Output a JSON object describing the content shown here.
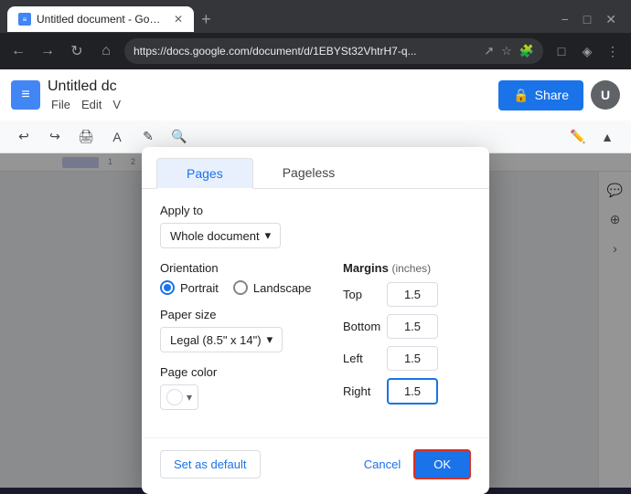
{
  "browser": {
    "tab_title": "Untitled document - Google Do...",
    "address": "https://docs.google.com/document/d/1EBYSt32VhtrH7-q...",
    "new_tab_label": "+",
    "favicon_label": "≡"
  },
  "app": {
    "title": "Untitled dc",
    "menu_items": [
      "File",
      "Edit",
      "V"
    ],
    "share_label": "Share",
    "docs_icon": "≡"
  },
  "dialog": {
    "tab_pages": "Pages",
    "tab_pageless": "Pageless",
    "apply_to_label": "Apply to",
    "apply_to_value": "Whole document",
    "orientation_label": "Orientation",
    "portrait_label": "Portrait",
    "landscape_label": "Landscape",
    "paper_size_label": "Paper size",
    "paper_size_value": "Legal (8.5\" x 14\")",
    "page_color_label": "Page color",
    "margins_label": "Margins",
    "margins_unit": "(inches)",
    "top_label": "Top",
    "top_value": "1.5",
    "bottom_label": "Bottom",
    "bottom_value": "1.5",
    "left_label": "Left",
    "left_value": "1.5",
    "right_label": "Right",
    "right_value": "1.5",
    "set_default_label": "Set as default",
    "cancel_label": "Cancel",
    "ok_label": "OK"
  }
}
